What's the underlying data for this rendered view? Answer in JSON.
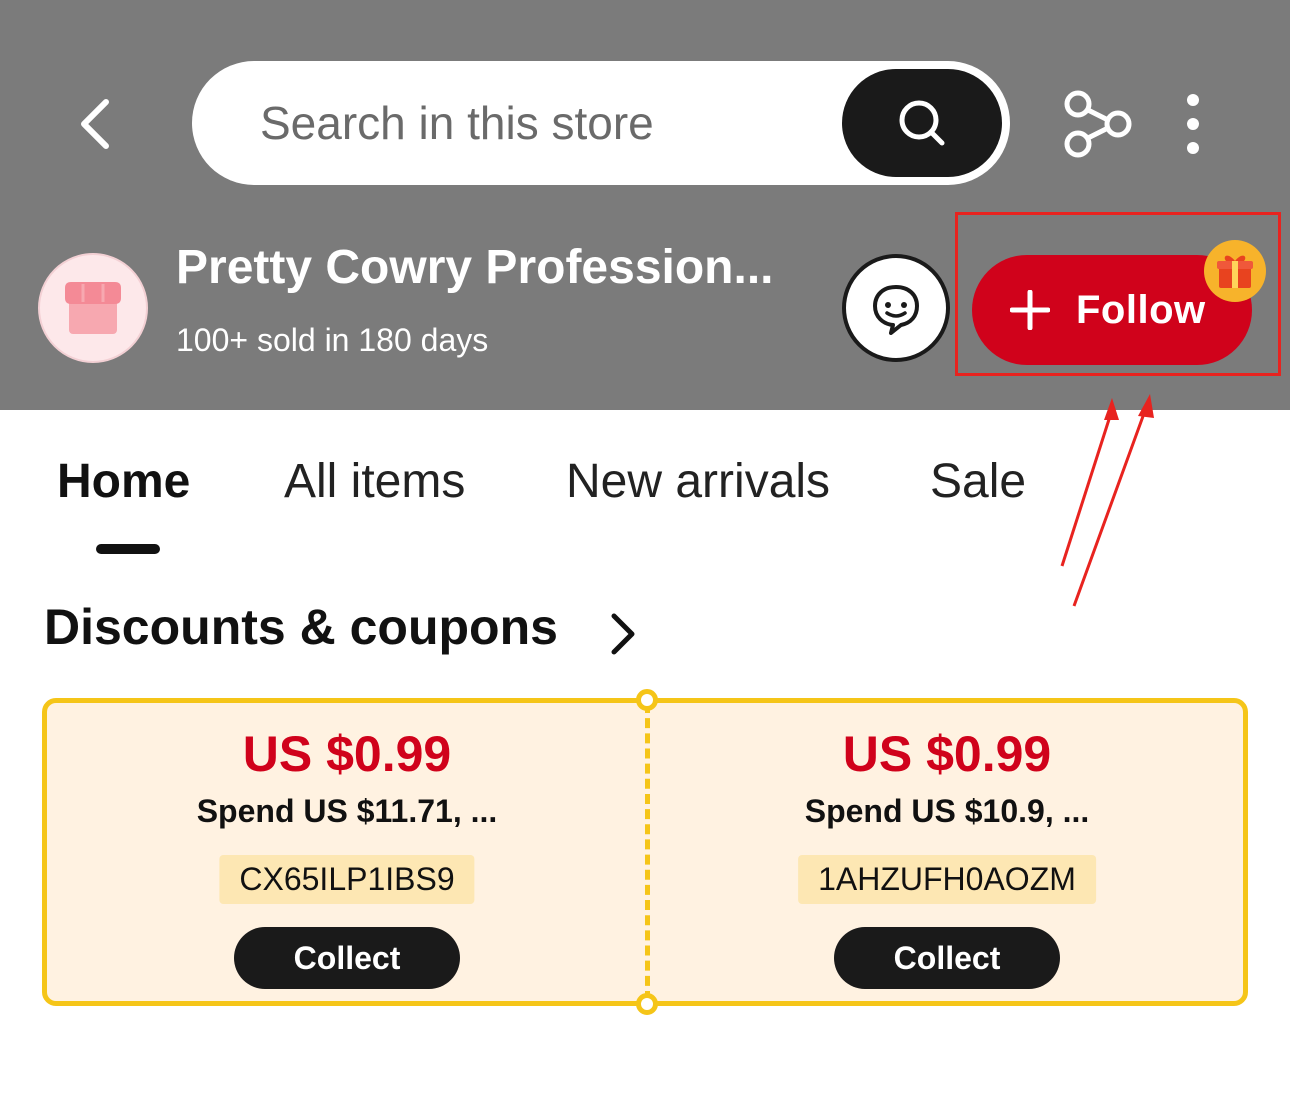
{
  "header": {
    "search": {
      "placeholder": "Search in this store"
    },
    "icons": [
      "back-arrow-icon",
      "search-icon",
      "share-icon",
      "more-vertical-icon"
    ]
  },
  "store": {
    "name": "Pretty Cowry Profession...",
    "sold": "100+ sold in 180 days",
    "follow_label": "Follow",
    "icons": [
      "store-logo-icon",
      "chat-icon",
      "plus-icon",
      "gift-icon"
    ]
  },
  "tabs": [
    {
      "label": "Home",
      "active": true
    },
    {
      "label": "All items",
      "active": false
    },
    {
      "label": "New arrivals",
      "active": false
    },
    {
      "label": "Sale",
      "active": false
    }
  ],
  "section": {
    "title": "Discounts & coupons"
  },
  "coupons": [
    {
      "amount": "US $0.99",
      "condition": "Spend US $11.71, ...",
      "code": "CX65ILP1IBS9",
      "button": "Collect"
    },
    {
      "amount": "US $0.99",
      "condition": "Spend US $10.9, ...",
      "code": "1AHZUFH0AOZM",
      "button": "Collect"
    }
  ],
  "colors": {
    "header_bg": "#7b7b7b",
    "follow_red": "#d0021b",
    "coupon_border": "#f5c518",
    "coupon_bg": "#fff2e1",
    "annotation_red": "#e8231f"
  }
}
